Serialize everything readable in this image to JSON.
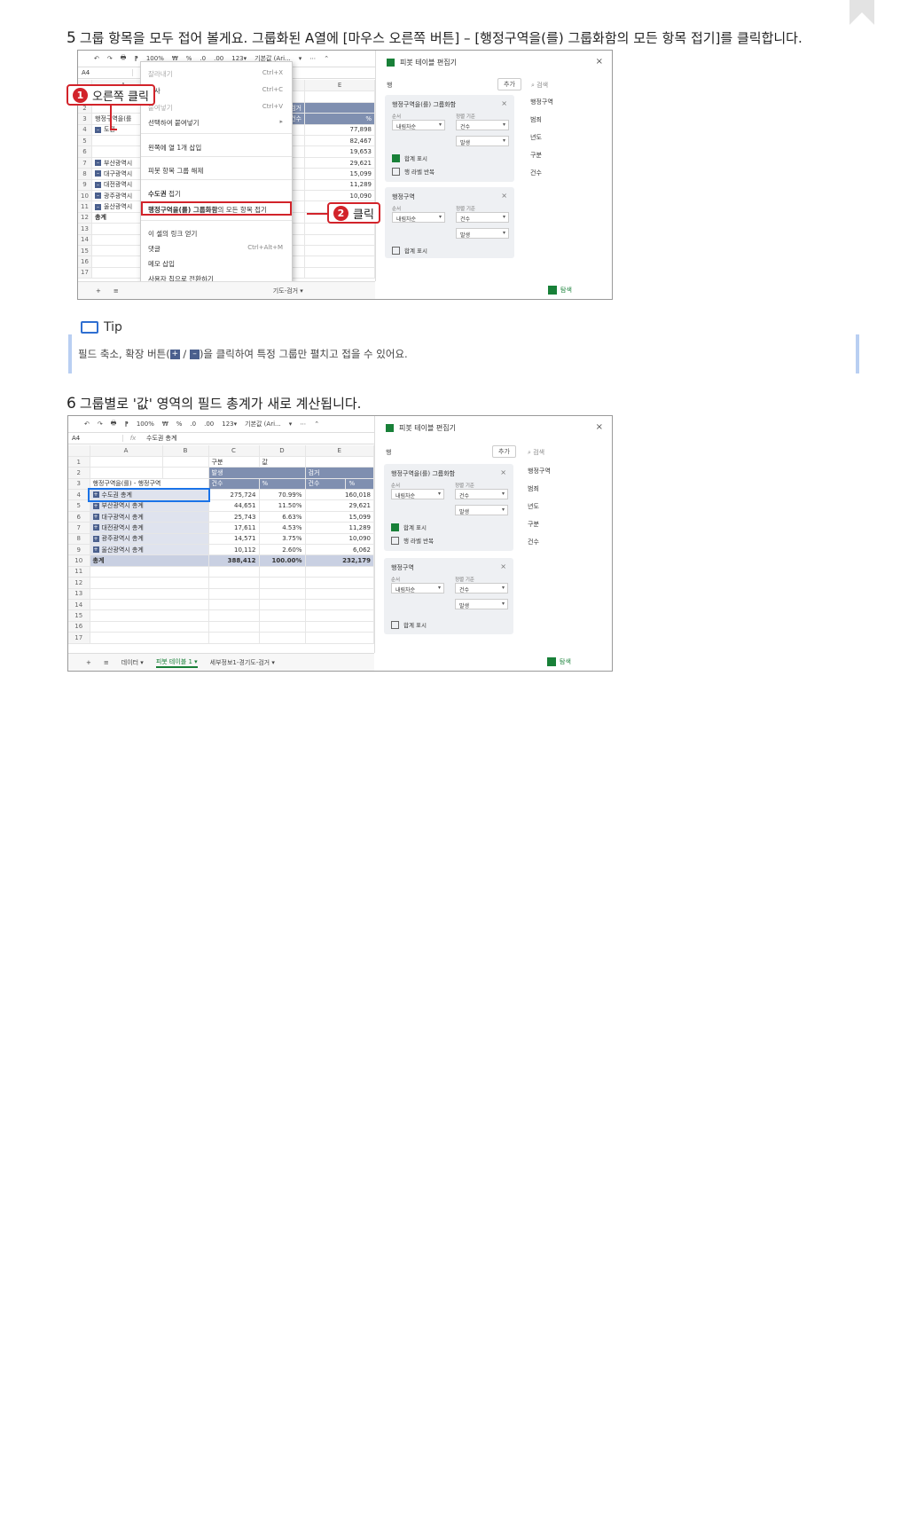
{
  "step5": {
    "num": "5",
    "text": "그룹 항목을 모두 접어 볼게요. 그룹화된 A열에 [마우스 오른쪽 버튼] – [행정구역을(를) 그룹화함의 모든 항목 접기]를 클릭합니다."
  },
  "shot1": {
    "toolbar": [
      "↶",
      "↷",
      "🖶",
      "⁋",
      "100%",
      "₩",
      "%",
      ".0",
      ".00",
      "123▾",
      "기본값 (Ari...",
      "▾",
      "⋯",
      "⌃"
    ],
    "cell_ref": "A4",
    "fx": "fx",
    "col_headers": [
      "",
      "A",
      "B",
      "",
      "",
      "E"
    ],
    "rows": [
      {
        "n": "1",
        "a": "",
        "e1": "",
        "e2": ""
      },
      {
        "n": "2",
        "a": "",
        "e1": "검거",
        "e2": ""
      },
      {
        "n": "3",
        "a": "행정구역을(를",
        "e1": "건수",
        "e2": "%"
      },
      {
        "n": "4",
        "a": "도권",
        "e1": "",
        "e2": "77,898"
      },
      {
        "n": "5",
        "a": "",
        "e1": "",
        "e2": "82,467"
      },
      {
        "n": "6",
        "a": "",
        "e1": "",
        "e2": "19,653"
      },
      {
        "n": "7",
        "a": "부산광역시",
        "e1": "",
        "e2": "29,621"
      },
      {
        "n": "8",
        "a": "대구광역시",
        "e1": "",
        "e2": "15,099"
      },
      {
        "n": "9",
        "a": "대전광역시",
        "e1": "",
        "e2": "11,289"
      },
      {
        "n": "10",
        "a": "광주광역시",
        "e1": "",
        "e2": "10,090"
      },
      {
        "n": "11",
        "a": "울산광역시",
        "e1": "",
        "e2": ""
      },
      {
        "n": "12",
        "a": "총계",
        "e1": "",
        "e2": ""
      },
      {
        "n": "13",
        "a": "",
        "e1": "",
        "e2": ""
      },
      {
        "n": "14",
        "a": "",
        "e1": "",
        "e2": ""
      },
      {
        "n": "15",
        "a": "",
        "e1": "",
        "e2": ""
      },
      {
        "n": "16",
        "a": "",
        "e1": "",
        "e2": ""
      },
      {
        "n": "17",
        "a": "",
        "e1": "",
        "e2": ""
      }
    ],
    "context_menu": {
      "cut": "잘라내기",
      "cut_sc": "Ctrl+X",
      "copy": "복사",
      "copy_sc": "Ctrl+C",
      "paste": "붙여넣기",
      "paste_sc": "Ctrl+V",
      "paste_special": "선택하여 붙여넣기",
      "paste_special_arrow": "▸",
      "insert_col": "왼쪽에 열 1개 삽입",
      "ungroup": "피봇 항목 그룹 해제",
      "collapse_one_bold": "수도권",
      "collapse_one_rest": " 접기",
      "collapse_all_bold": "행정구역을(를) 그룹화함",
      "collapse_all_rest": "의 모든 항목 접기",
      "get_link": "이 셀의 링크 얻기",
      "comment": "댓글",
      "comment_sc": "Ctrl+Alt+M",
      "note": "메모 삽입",
      "smart_chip": "사용자 칩으로 전환하기"
    },
    "tabs": [
      "+",
      "≡",
      "기도-검거 ▾"
    ],
    "callout1": {
      "num": "1",
      "text": "오른쪽 클릭"
    },
    "callout2": {
      "num": "2",
      "text": "클릭"
    }
  },
  "editor": {
    "title": "피봇 테이블 편집기",
    "close": "×",
    "rows_label": "행",
    "add": "추가",
    "search": "검색",
    "box1": {
      "title": "행정구역을(를) 그룹화함",
      "order_label": "순서",
      "sort_label": "정렬 기준",
      "order": "내림차순",
      "sort": "건수",
      "sort2": "발생",
      "total": "합계 표시",
      "repeat": "행 라벨 반복"
    },
    "box2": {
      "title": "행정구역",
      "order_label": "순서",
      "sort_label": "정렬 기준",
      "order": "내림차순",
      "sort": "건수",
      "sort2": "발생",
      "total": "합계 표시"
    },
    "fields": [
      "행정구역",
      "범죄",
      "년도",
      "구분",
      "건수"
    ],
    "explore": "탐색"
  },
  "tip": {
    "title": "Tip",
    "text_a": "필드 축소, 확장 버튼(",
    "plus": "+",
    "slash": " / ",
    "minus": "–",
    "text_b": ")을 클릭하여 특정 그룹만 펼치고 접을 수 있어요."
  },
  "step6": {
    "num": "6",
    "text": "그룹별로 '값' 영역의 필드 총계가 새로 계산됩니다."
  },
  "shot2": {
    "toolbar": [
      "↶",
      "↷",
      "🖶",
      "⁋",
      "100%",
      "₩",
      "%",
      ".0",
      ".00",
      "123▾",
      "기본값 (Ari...",
      "▾",
      "⋯",
      "⌃"
    ],
    "cell_ref": "A4",
    "fx": "fx",
    "formula": "수도권 총계",
    "col_headers": [
      "",
      "A",
      "B",
      "C",
      "D",
      "E"
    ],
    "row1": {
      "c": "구분",
      "d": "값"
    },
    "row2": {
      "c": "발생",
      "e": "검거"
    },
    "row3": {
      "a": "행정구역을(를) - 행정구역",
      "c": "건수",
      "d": "%",
      "e1": "건수",
      "e2": "%"
    },
    "data_rows": [
      {
        "n": "4",
        "label": "수도권 총계",
        "c": "275,724",
        "d": "70.99%",
        "e": "160,018"
      },
      {
        "n": "5",
        "label": "부산광역시 총계",
        "c": "44,651",
        "d": "11.50%",
        "e": "29,621"
      },
      {
        "n": "6",
        "label": "대구광역시 총계",
        "c": "25,743",
        "d": "6.63%",
        "e": "15,099"
      },
      {
        "n": "7",
        "label": "대전광역시 총계",
        "c": "17,611",
        "d": "4.53%",
        "e": "11,289"
      },
      {
        "n": "8",
        "label": "광주광역시 총계",
        "c": "14,571",
        "d": "3.75%",
        "e": "10,090"
      },
      {
        "n": "9",
        "label": "울산광역시 총계",
        "c": "10,112",
        "d": "2.60%",
        "e": "6,062"
      }
    ],
    "total_row": {
      "n": "10",
      "label": "총계",
      "c": "388,412",
      "d": "100.00%",
      "e": "232,179"
    },
    "empty_rows": [
      "11",
      "12",
      "13",
      "14",
      "15",
      "16",
      "17"
    ],
    "tabs": [
      "+",
      "≡",
      "데이터 ▾",
      "피봇 테이블 1 ▾",
      "세부정보1-경기도-검거 ▾"
    ]
  }
}
